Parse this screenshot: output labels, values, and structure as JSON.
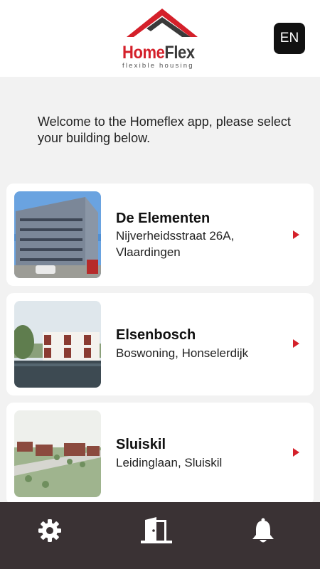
{
  "header": {
    "logo_part1": "Home",
    "logo_part2": "Flex",
    "logo_tagline": "flexible housing",
    "language": "EN"
  },
  "welcome_text": "Welcome to the Homeflex app, please select your building below.",
  "buildings": [
    {
      "name": "De Elementen",
      "address": "Nijverheidsstraat 26A, Vlaardingen"
    },
    {
      "name": "Elsenbosch",
      "address": "Boswoning, Honselerdijk"
    },
    {
      "name": "Sluiskil",
      "address": "Leidinglaan, Sluiskil"
    }
  ],
  "nav": {
    "items": [
      "settings-icon",
      "door-exit-icon",
      "bell-icon"
    ]
  },
  "colors": {
    "brand_red": "#d4202a",
    "nav_bg": "#3a3234",
    "background": "#f2f2f2"
  }
}
